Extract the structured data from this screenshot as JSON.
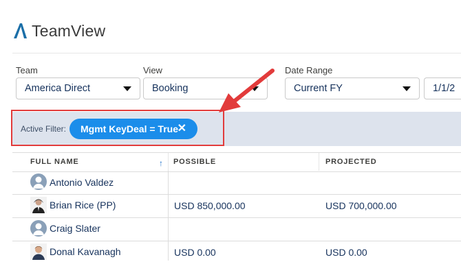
{
  "app": {
    "title": "TeamView"
  },
  "filters": {
    "team": {
      "label": "Team",
      "value": "America Direct"
    },
    "view": {
      "label": "View",
      "value": "Booking"
    },
    "date_range": {
      "label": "Date Range",
      "value": "Current FY"
    },
    "date_start": {
      "value": "1/1/2"
    }
  },
  "active_filter": {
    "label": "Active Filter:",
    "pill": "Mgmt KeyDeal = True",
    "remove": "✕"
  },
  "colors": {
    "accent": "#1b8dea",
    "highlight": "#e23b3b",
    "filter_bg": "#dde3ed"
  },
  "table": {
    "columns": [
      "FULL NAME",
      "POSSIBLE",
      "PROJECTED"
    ],
    "sort_indicator": "↑",
    "rows": [
      {
        "name": "Antonio Valdez",
        "possible": "",
        "projected": "",
        "avatar": "default-avatar-icon"
      },
      {
        "name": "Brian Rice (PP)",
        "possible": "USD 850,000.00",
        "projected": "USD 700,000.00",
        "avatar": "photo"
      },
      {
        "name": "Craig Slater",
        "possible": "",
        "projected": "",
        "avatar": "default-avatar-icon"
      },
      {
        "name": "Donal Kavanagh",
        "possible": "USD 0.00",
        "projected": "USD 0.00",
        "avatar": "photo"
      }
    ]
  }
}
